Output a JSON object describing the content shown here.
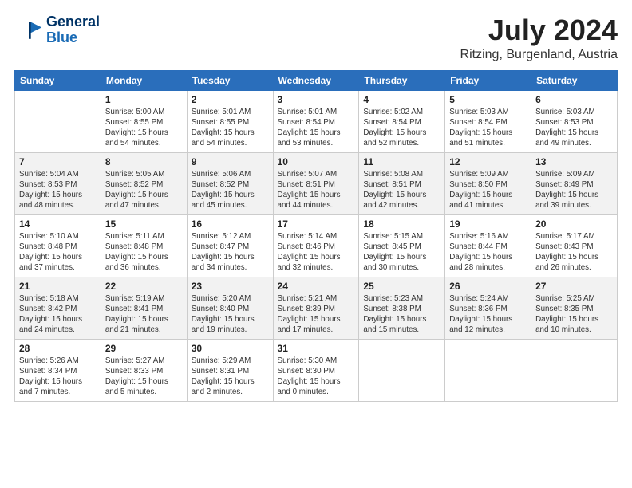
{
  "logo": {
    "line1": "General",
    "line2": "Blue"
  },
  "title": "July 2024",
  "location": "Ritzing, Burgenland, Austria",
  "days_of_week": [
    "Sunday",
    "Monday",
    "Tuesday",
    "Wednesday",
    "Thursday",
    "Friday",
    "Saturday"
  ],
  "weeks": [
    [
      {
        "day": "",
        "info": ""
      },
      {
        "day": "1",
        "info": "Sunrise: 5:00 AM\nSunset: 8:55 PM\nDaylight: 15 hours\nand 54 minutes."
      },
      {
        "day": "2",
        "info": "Sunrise: 5:01 AM\nSunset: 8:55 PM\nDaylight: 15 hours\nand 54 minutes."
      },
      {
        "day": "3",
        "info": "Sunrise: 5:01 AM\nSunset: 8:54 PM\nDaylight: 15 hours\nand 53 minutes."
      },
      {
        "day": "4",
        "info": "Sunrise: 5:02 AM\nSunset: 8:54 PM\nDaylight: 15 hours\nand 52 minutes."
      },
      {
        "day": "5",
        "info": "Sunrise: 5:03 AM\nSunset: 8:54 PM\nDaylight: 15 hours\nand 51 minutes."
      },
      {
        "day": "6",
        "info": "Sunrise: 5:03 AM\nSunset: 8:53 PM\nDaylight: 15 hours\nand 49 minutes."
      }
    ],
    [
      {
        "day": "7",
        "info": "Sunrise: 5:04 AM\nSunset: 8:53 PM\nDaylight: 15 hours\nand 48 minutes."
      },
      {
        "day": "8",
        "info": "Sunrise: 5:05 AM\nSunset: 8:52 PM\nDaylight: 15 hours\nand 47 minutes."
      },
      {
        "day": "9",
        "info": "Sunrise: 5:06 AM\nSunset: 8:52 PM\nDaylight: 15 hours\nand 45 minutes."
      },
      {
        "day": "10",
        "info": "Sunrise: 5:07 AM\nSunset: 8:51 PM\nDaylight: 15 hours\nand 44 minutes."
      },
      {
        "day": "11",
        "info": "Sunrise: 5:08 AM\nSunset: 8:51 PM\nDaylight: 15 hours\nand 42 minutes."
      },
      {
        "day": "12",
        "info": "Sunrise: 5:09 AM\nSunset: 8:50 PM\nDaylight: 15 hours\nand 41 minutes."
      },
      {
        "day": "13",
        "info": "Sunrise: 5:09 AM\nSunset: 8:49 PM\nDaylight: 15 hours\nand 39 minutes."
      }
    ],
    [
      {
        "day": "14",
        "info": "Sunrise: 5:10 AM\nSunset: 8:48 PM\nDaylight: 15 hours\nand 37 minutes."
      },
      {
        "day": "15",
        "info": "Sunrise: 5:11 AM\nSunset: 8:48 PM\nDaylight: 15 hours\nand 36 minutes."
      },
      {
        "day": "16",
        "info": "Sunrise: 5:12 AM\nSunset: 8:47 PM\nDaylight: 15 hours\nand 34 minutes."
      },
      {
        "day": "17",
        "info": "Sunrise: 5:14 AM\nSunset: 8:46 PM\nDaylight: 15 hours\nand 32 minutes."
      },
      {
        "day": "18",
        "info": "Sunrise: 5:15 AM\nSunset: 8:45 PM\nDaylight: 15 hours\nand 30 minutes."
      },
      {
        "day": "19",
        "info": "Sunrise: 5:16 AM\nSunset: 8:44 PM\nDaylight: 15 hours\nand 28 minutes."
      },
      {
        "day": "20",
        "info": "Sunrise: 5:17 AM\nSunset: 8:43 PM\nDaylight: 15 hours\nand 26 minutes."
      }
    ],
    [
      {
        "day": "21",
        "info": "Sunrise: 5:18 AM\nSunset: 8:42 PM\nDaylight: 15 hours\nand 24 minutes."
      },
      {
        "day": "22",
        "info": "Sunrise: 5:19 AM\nSunset: 8:41 PM\nDaylight: 15 hours\nand 21 minutes."
      },
      {
        "day": "23",
        "info": "Sunrise: 5:20 AM\nSunset: 8:40 PM\nDaylight: 15 hours\nand 19 minutes."
      },
      {
        "day": "24",
        "info": "Sunrise: 5:21 AM\nSunset: 8:39 PM\nDaylight: 15 hours\nand 17 minutes."
      },
      {
        "day": "25",
        "info": "Sunrise: 5:23 AM\nSunset: 8:38 PM\nDaylight: 15 hours\nand 15 minutes."
      },
      {
        "day": "26",
        "info": "Sunrise: 5:24 AM\nSunset: 8:36 PM\nDaylight: 15 hours\nand 12 minutes."
      },
      {
        "day": "27",
        "info": "Sunrise: 5:25 AM\nSunset: 8:35 PM\nDaylight: 15 hours\nand 10 minutes."
      }
    ],
    [
      {
        "day": "28",
        "info": "Sunrise: 5:26 AM\nSunset: 8:34 PM\nDaylight: 15 hours\nand 7 minutes."
      },
      {
        "day": "29",
        "info": "Sunrise: 5:27 AM\nSunset: 8:33 PM\nDaylight: 15 hours\nand 5 minutes."
      },
      {
        "day": "30",
        "info": "Sunrise: 5:29 AM\nSunset: 8:31 PM\nDaylight: 15 hours\nand 2 minutes."
      },
      {
        "day": "31",
        "info": "Sunrise: 5:30 AM\nSunset: 8:30 PM\nDaylight: 15 hours\nand 0 minutes."
      },
      {
        "day": "",
        "info": ""
      },
      {
        "day": "",
        "info": ""
      },
      {
        "day": "",
        "info": ""
      }
    ]
  ]
}
